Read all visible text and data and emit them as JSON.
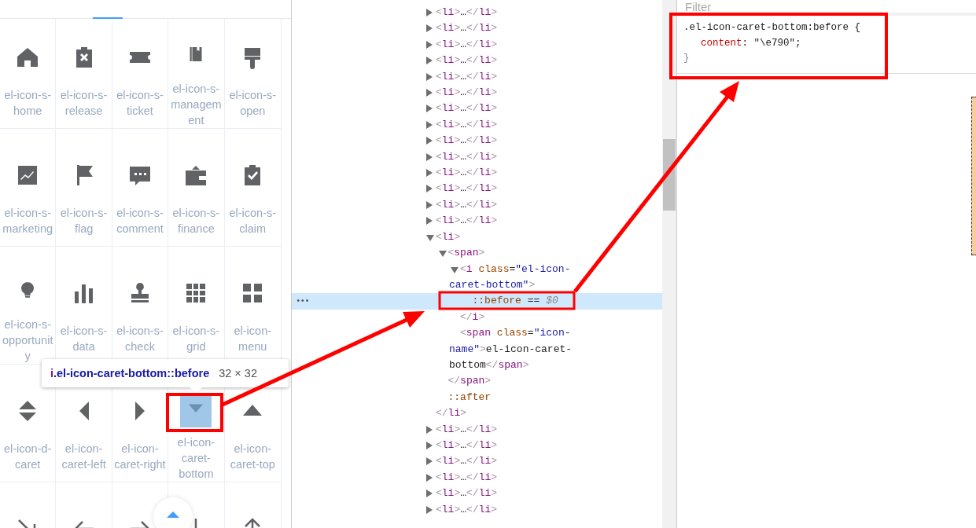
{
  "icon_panel": {
    "items": [
      {
        "kind": "home",
        "label": "el-icon-s-home",
        "highlighted": false
      },
      {
        "kind": "release",
        "label": "el-icon-s-release",
        "highlighted": false
      },
      {
        "kind": "ticket",
        "label": "el-icon-s-ticket",
        "highlighted": false
      },
      {
        "kind": "management",
        "label": "el-icon-s-management",
        "highlighted": false
      },
      {
        "kind": "open",
        "label": "el-icon-s-open",
        "highlighted": false
      },
      {
        "kind": "marketing",
        "label": "el-icon-s-marketing",
        "highlighted": false
      },
      {
        "kind": "flag",
        "label": "el-icon-s-flag",
        "highlighted": false
      },
      {
        "kind": "comment",
        "label": "el-icon-s-comment",
        "highlighted": false
      },
      {
        "kind": "finance",
        "label": "el-icon-s-finance",
        "highlighted": false
      },
      {
        "kind": "claim",
        "label": "el-icon-s-claim",
        "highlighted": false
      },
      {
        "kind": "opportunity",
        "label": "el-icon-s-opportunity",
        "highlighted": false
      },
      {
        "kind": "data",
        "label": "el-icon-s-data",
        "highlighted": false
      },
      {
        "kind": "check",
        "label": "el-icon-s-check",
        "highlighted": false
      },
      {
        "kind": "grid",
        "label": "el-icon-s-grid",
        "highlighted": false
      },
      {
        "kind": "menu",
        "label": "el-icon-menu",
        "highlighted": false
      },
      {
        "kind": "dcaret",
        "label": "el-icon-d-caret",
        "highlighted": false
      },
      {
        "kind": "caretLeft",
        "label": "el-icon-caret-left",
        "highlighted": false
      },
      {
        "kind": "caretRight",
        "label": "el-icon-caret-right",
        "highlighted": false
      },
      {
        "kind": "caretBottom",
        "label": "el-icon-caret-bottom",
        "highlighted": true
      },
      {
        "kind": "caretTop",
        "label": "el-icon-caret-top",
        "highlighted": false
      },
      {
        "kind": "arrowBottomRight",
        "highlighted": false
      },
      {
        "kind": "arrowLeft",
        "highlighted": false
      },
      {
        "kind": "arrowRight",
        "highlighted": false
      },
      {
        "kind": "arrowBottom",
        "highlighted": false
      },
      {
        "kind": "arrowTop",
        "highlighted": false
      }
    ],
    "tooltip": {
      "tag": "i",
      "selector": ".el-icon-caret-bottom::before",
      "size": "32 × 32"
    }
  },
  "elements": {
    "nodes": [
      {
        "label": "<li>…</li>",
        "expanded": false,
        "selected": false
      },
      {
        "label": "<li>…</li>",
        "expanded": false,
        "selected": false
      },
      {
        "label": "<li>…</li>",
        "expanded": false,
        "selected": false
      },
      {
        "label": "<li>…</li>",
        "expanded": false,
        "selected": false
      },
      {
        "label": "<li>…</li>",
        "expanded": false,
        "selected": false
      },
      {
        "label": "<li>…</li>",
        "expanded": false,
        "selected": false
      },
      {
        "label": "<li>…</li>",
        "expanded": false,
        "selected": false
      },
      {
        "label": "<li>…</li>",
        "expanded": false,
        "selected": false
      },
      {
        "label": "<li>…</li>",
        "expanded": false,
        "selected": false
      },
      {
        "label": "<li>…</li>",
        "expanded": false,
        "selected": false
      },
      {
        "label": "<li>…</li>",
        "expanded": false,
        "selected": false
      },
      {
        "label": "<li>…</li>",
        "expanded": false,
        "selected": false
      },
      {
        "label": "<li>…</li>",
        "expanded": false,
        "selected": false
      },
      {
        "label": "<li>…</li>",
        "expanded": false,
        "selected": false
      },
      {
        "label": "<li>",
        "expanded": true,
        "selected": false,
        "closing": "</li>",
        "children": [
          {
            "label": "<span>",
            "expanded": true,
            "selected": false,
            "closing": "</span>",
            "children": [
              {
                "label": "<i class=\"el-icon-caret-bottom\">",
                "expanded": true,
                "selected": false,
                "closing": "</i>",
                "children": [
                  {
                    "label": "::before == $0",
                    "selected": true,
                    "more": "•••"
                  }
                ]
              },
              {
                "label": "<span class=\"icon-name\">el-icon-caret-bottom</span>",
                "selected": false
              }
            ]
          },
          {
            "label": "::after",
            "selected": false
          }
        ]
      },
      {
        "label": "<li>…</li>",
        "expanded": false,
        "selected": false
      },
      {
        "label": "<li>…</li>",
        "expanded": false,
        "selected": false
      },
      {
        "label": "<li>…</li>",
        "expanded": false,
        "selected": false
      },
      {
        "label": "<li>…</li>",
        "expanded": false,
        "selected": false
      },
      {
        "label": "<li>…</li>",
        "expanded": false,
        "selected": false
      },
      {
        "label": "<li>…</li>",
        "expanded": false,
        "selected": false
      }
    ]
  },
  "styles": {
    "filter": {
      "placeholder": "Filter"
    },
    "rules": [
      {
        "selector": ".el-icon-caret-bottom:before {",
        "declarations": [
          "content: \"\\e790\";"
        ],
        "closing": "}"
      }
    ]
  }
}
